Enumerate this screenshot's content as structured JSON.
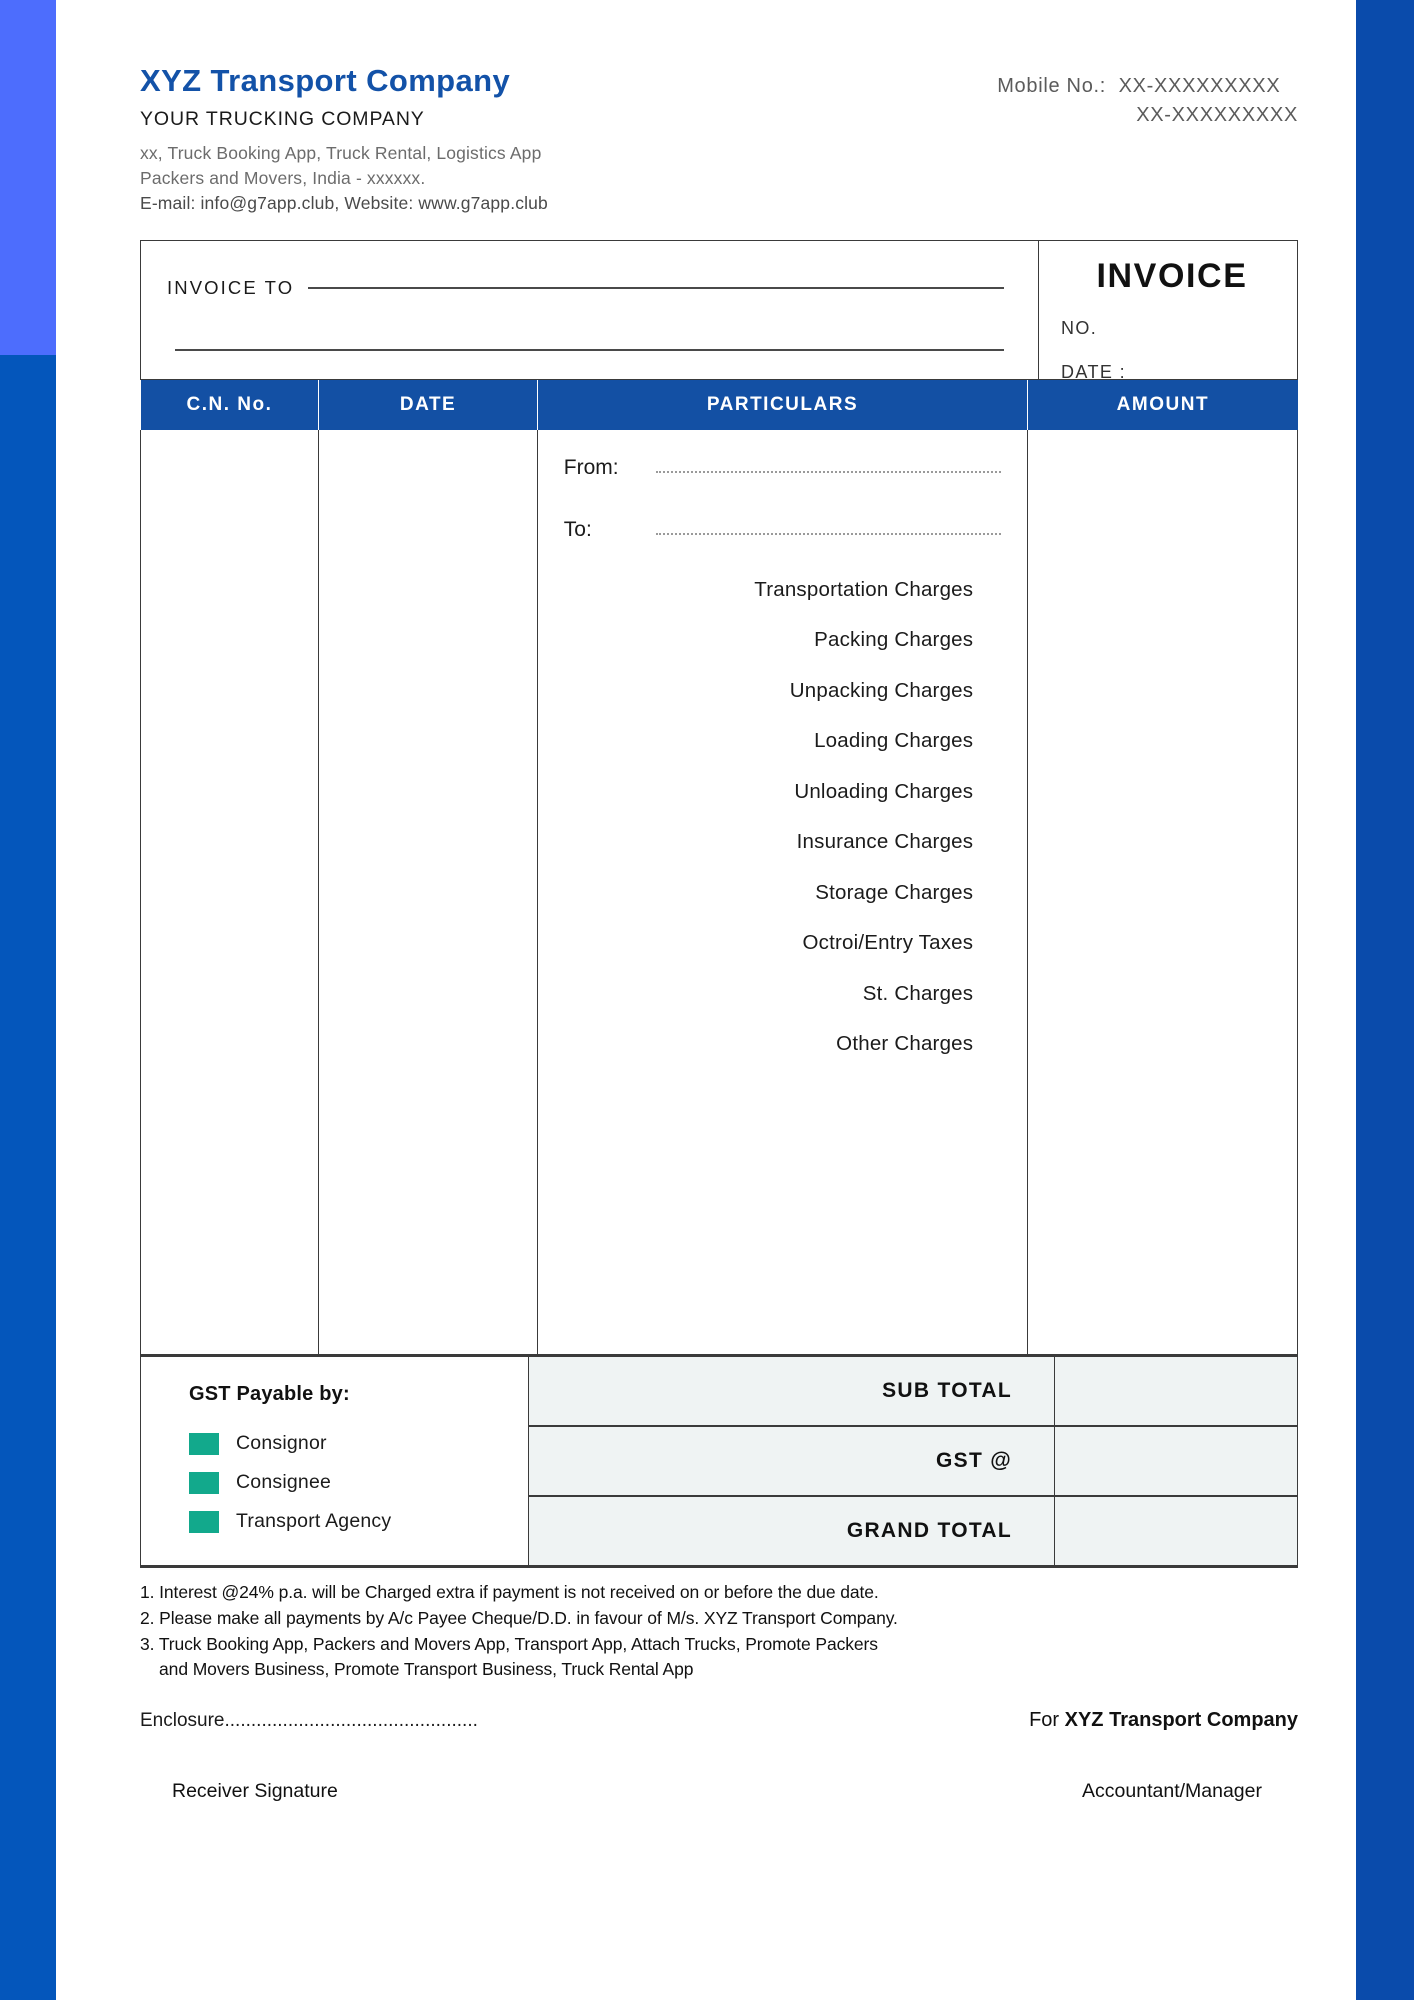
{
  "theme": {
    "brand_blue": "#1352a8",
    "header_blue": "#1350a4",
    "bar_left_top": "#4d6dfd",
    "bar_left_bottom": "#0456bb",
    "bar_right": "#0a4bab",
    "checkbox_teal": "#12a98c",
    "totals_fill": "#eff3f3"
  },
  "header": {
    "company_name": "XYZ  Transport Company",
    "tagline": "YOUR TRUCKING COMPANY",
    "address_line1": "xx, Truck  Booking App, Truck Rental, Logistics App",
    "address_line2": "Packers and Movers, India - xxxxxx.",
    "address_line3": "E-mail: info@g7app.club, Website: www.g7app.club",
    "mobile_label": "Mobile No.:",
    "mobile_1": "XX-XXXXXXXXX",
    "mobile_2": "XX-XXXXXXXXX"
  },
  "invoice_box": {
    "invoice_to_label": "INVOICE TO",
    "invoice_to_value": "",
    "invoice_to_value2": "",
    "invoice_word": "INVOICE",
    "no_label": "NO.",
    "no_value": "",
    "date_label": "DATE :",
    "date_value": ""
  },
  "table": {
    "columns": [
      "C.N. No.",
      "DATE",
      "PARTICULARS",
      "AMOUNT"
    ],
    "cn_no_value": "",
    "date_value": "",
    "amount_value": "",
    "from_label": "From:",
    "from_value": "",
    "to_label": "To:",
    "to_value": "",
    "charges": [
      "Transportation Charges",
      "Packing Charges",
      "Unpacking Charges",
      "Loading Charges",
      "Unloading Charges",
      "Insurance Charges",
      "Storage Charges",
      "Octroi/Entry Taxes",
      "St. Charges",
      "Other Charges"
    ]
  },
  "gst": {
    "title": "GST Payable by:",
    "options": [
      "Consignor",
      "Consignee",
      "Transport Agency"
    ]
  },
  "totals": {
    "rows": [
      {
        "label": "SUB TOTAL",
        "value": ""
      },
      {
        "label": "GST @",
        "value": ""
      },
      {
        "label": "GRAND TOTAL",
        "value": ""
      }
    ]
  },
  "terms": {
    "line1": "1. Interest @24% p.a. will be Charged extra if payment is not received on or before the due date.",
    "line2": "2. Please make all payments by A/c Payee Cheque/D.D. in favour of M/s. XYZ Transport Company.",
    "line3": "3. Truck Booking App, Packers and Movers App, Transport App, Attach Trucks, Promote Packers",
    "line4": "    and Movers Business, Promote Transport Business, Truck Rental App"
  },
  "footer": {
    "enclosure": "Enclosure................................................",
    "for_prefix": "For ",
    "for_company": "XYZ Transport Company",
    "receiver_signature": "Receiver Signature",
    "accountant_manager": "Accountant/Manager"
  }
}
